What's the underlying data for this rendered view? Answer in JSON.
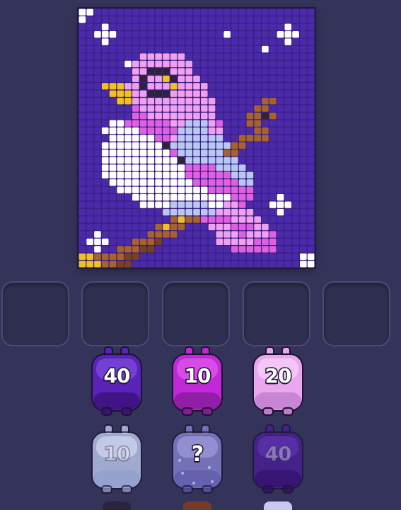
{
  "board": {
    "palette": {
      "0": "#4a2aa8",
      "1": "#ffffff",
      "2": "#f0a0ec",
      "3": "#e060e0",
      "4": "#b8c8f0",
      "5": "#f2c21a",
      "6": "#2c2438",
      "7": "#a8622a",
      "8": "#7a4216",
      "9": "#c82ad0",
      "a": "#5a34c0",
      "b": "#dfe6ff"
    },
    "rows": [
      "1100000000000000000000000000000",
      "1000000000000000000000000000000",
      "0001000000000000000000000001000",
      "0011100000000000000100000011100",
      "0001000000000000000000000001000",
      "0000000000000000000000001000000",
      "0000000022222200000000000000000",
      "0000001222222220000000000000000",
      "0000000226662220000000000000000",
      "0000000262256222000000000000000",
      "0005552262225222200000000000000",
      "0000555226662222200000000000000",
      "0000055222222222220000007700000",
      "0000000322222222220000077000000",
      "0000000332222222220000776700000",
      "0000113333332244423000770000000",
      "0001111133333444422000077000000",
      "0000111111332444444007777000000",
      "0001111111164444444477000000000",
      "0001111111113444444770000000000",
      "0001111111111644444440000000000",
      "0001111111111133334444000000000",
      "0001111111111133333344400000000",
      "0000111111111113333334400000000",
      "0000011111111111133333300000000",
      "0000000111111111111133300010000",
      "0000000011114444411223000111000",
      "0000000000044444442222200010000",
      "0000000000007577333322220000000",
      "0000000000757700022233322000000",
      "0010000007777000002223222300000",
      "0111000777800000002222233300000",
      "0010077788000000000033333300000",
      "5577778800000000000000000000011",
      "5557788000000000000000000000011"
    ]
  },
  "slots": [
    {
      "id": "slot-1"
    },
    {
      "id": "slot-2"
    },
    {
      "id": "slot-3"
    },
    {
      "id": "slot-4"
    },
    {
      "id": "slot-5"
    }
  ],
  "jars": [
    {
      "count": "40",
      "color": "#5a22b8",
      "highlight": "#8a5ae8",
      "shade": "#3a127a",
      "state": "active"
    },
    {
      "count": "10",
      "color": "#c028d8",
      "highlight": "#e86af0",
      "shade": "#861a9a",
      "state": "active"
    },
    {
      "count": "20",
      "color": "#eaa6ee",
      "highlight": "#fbe0fb",
      "shade": "#c07ccc",
      "state": "active"
    },
    {
      "count": "10",
      "color": "#c4d2f6",
      "highlight": "#eef2ff",
      "shade": "#8c9cd0",
      "state": "faded"
    },
    {
      "count": "?",
      "color": "#8a86d8",
      "highlight": "#b8b4f0",
      "shade": "#5a56a8",
      "state": "mystery"
    },
    {
      "count": "40",
      "color": "#4a1c9a",
      "highlight": "#6a40c0",
      "shade": "#2e0e66",
      "state": "faded"
    }
  ],
  "peeks": [
    {
      "color": "#2a2440"
    },
    {
      "color": "#7a3a2a"
    },
    {
      "color": "#c8c8f0"
    }
  ]
}
